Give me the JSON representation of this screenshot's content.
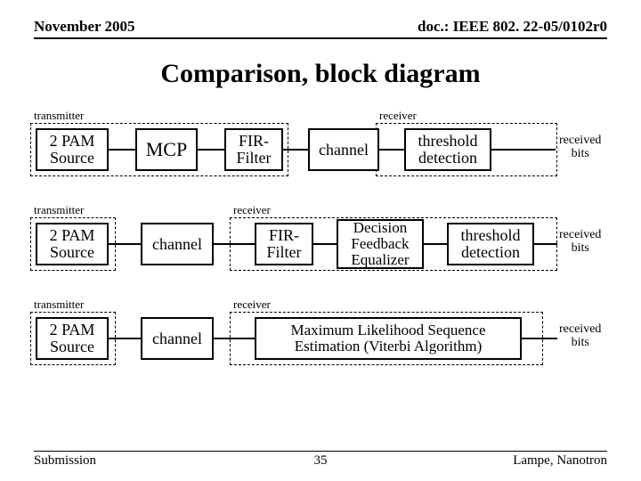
{
  "header": {
    "left": "November 2005",
    "right": "doc.: IEEE 802. 22-05/0102r0"
  },
  "title": "Comparison, block diagram",
  "rows": [
    {
      "tx_label": "transmitter",
      "rx_label": "receiver",
      "out1": "received",
      "out2": "bits",
      "b1": "2 PAM\nSource",
      "b2": "MCP",
      "b3": "FIR-\nFilter",
      "b4": "channel",
      "b5": "threshold\ndetection"
    },
    {
      "tx_label": "transmitter",
      "rx_label": "receiver",
      "out1": "received",
      "out2": "bits",
      "b1": "2 PAM\nSource",
      "b2": "channel",
      "b3": "FIR-\nFilter",
      "b4": "Decision\nFeedback\nEqualizer",
      "b5": "threshold\ndetection"
    },
    {
      "tx_label": "transmitter",
      "rx_label": "receiver",
      "out1": "received",
      "out2": "bits",
      "b1": "2 PAM\nSource",
      "b2": "channel",
      "b3": "Maximum Likelihood Sequence\nEstimation (Viterbi Algorithm)"
    }
  ],
  "footer": {
    "left": "Submission",
    "right": "Lampe, Nanotron",
    "page": "35"
  }
}
